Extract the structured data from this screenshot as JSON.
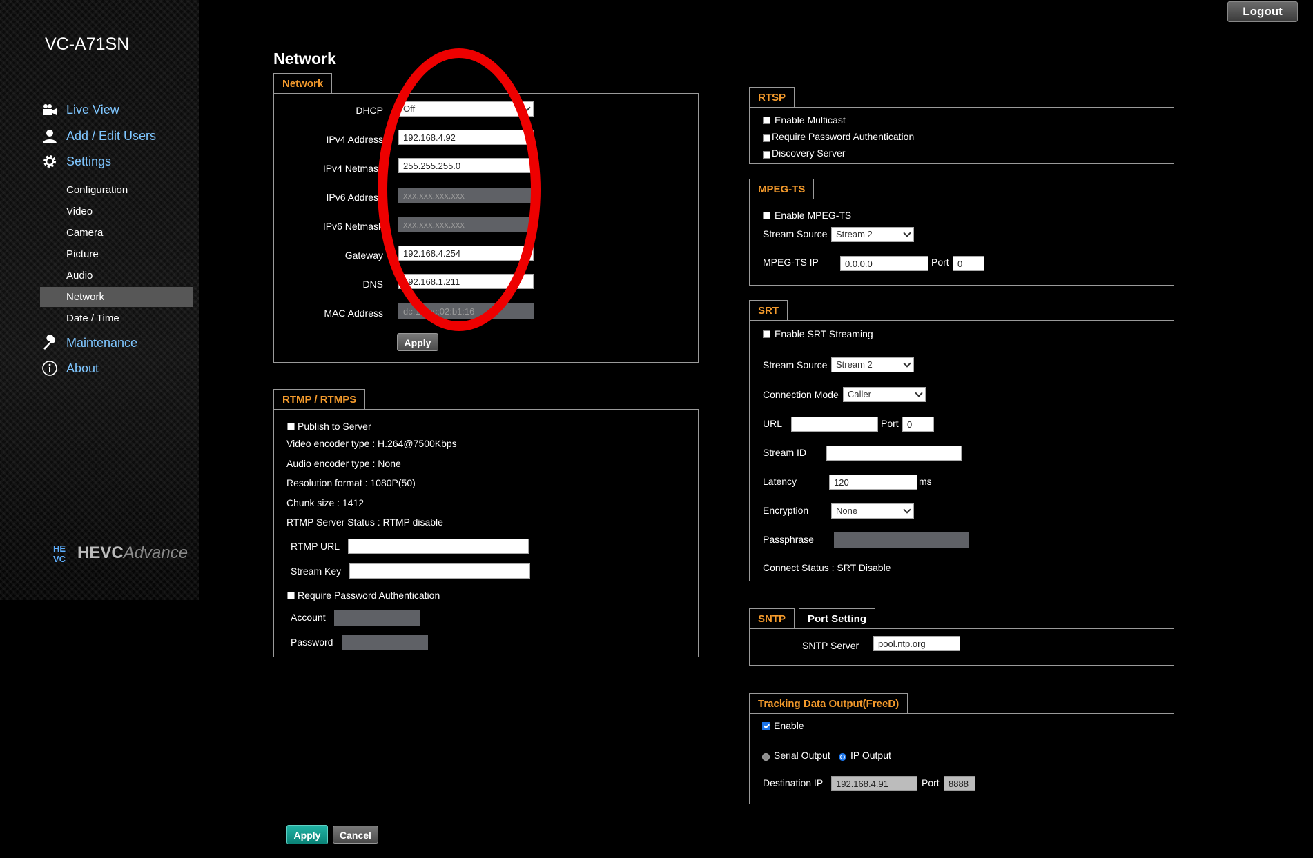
{
  "model_name": "VC-A71SN",
  "logout_label": "Logout",
  "page_title": "Network",
  "nav": {
    "main": [
      {
        "label": "Live View",
        "icon": "camera-icon"
      },
      {
        "label": "Add / Edit Users",
        "icon": "user-icon"
      },
      {
        "label": "Settings",
        "icon": "gear-icon"
      },
      {
        "label": "Maintenance",
        "icon": "wrench-icon"
      },
      {
        "label": "About",
        "icon": "info-icon"
      }
    ],
    "sub": [
      "Configuration",
      "Video",
      "Camera",
      "Picture",
      "Audio",
      "Network",
      "Date / Time"
    ],
    "active_sub": "Network"
  },
  "logo": {
    "mark": "HE\nVC",
    "text_bold": "HEVC",
    "text_light": "Advance"
  },
  "network_panel": {
    "tab": "Network",
    "fields": [
      {
        "label": "DHCP",
        "value": "Off",
        "type": "select"
      },
      {
        "label": "IPv4 Address",
        "value": "192.168.4.92",
        "type": "text"
      },
      {
        "label": "IPv4 Netmask",
        "value": "255.255.255.0",
        "type": "text"
      },
      {
        "label": "IPv6 Address",
        "value": "xxx.xxx.xxx.xxx",
        "type": "disabled"
      },
      {
        "label": "IPv6 Netmask",
        "value": "xxx.xxx.xxx.xxx",
        "type": "disabled"
      },
      {
        "label": "Gateway",
        "value": "192.168.4.254",
        "type": "text"
      },
      {
        "label": "DNS",
        "value": "192.168.1.211",
        "type": "text"
      },
      {
        "label": "MAC Address",
        "value": "dc:12:ac:02:b1:16",
        "type": "disabled"
      }
    ],
    "apply_label": "Apply"
  },
  "rtmp_panel": {
    "tab": "RTMP / RTMPS",
    "publish_label": "Publish to Server",
    "publish_checked": false,
    "info": [
      "Video encoder type : H.264@7500Kbps",
      "Audio encoder type : None",
      "Resolution format : 1080P(50)",
      "Chunk size : 1412",
      "RTMP Server Status : RTMP disable"
    ],
    "rtmp_url_label": "RTMP URL",
    "rtmp_url_value": "",
    "stream_key_label": "Stream Key",
    "stream_key_value": "",
    "require_auth_label": "Require Password Authentication",
    "require_auth_checked": false,
    "account_label": "Account",
    "password_label": "Password"
  },
  "rtsp_panel": {
    "tab": "RTSP",
    "options": [
      {
        "label": "Enable Multicast",
        "checked": false
      },
      {
        "label": "Require Password Authentication",
        "checked": false
      },
      {
        "label": "Discovery Server",
        "checked": false
      }
    ]
  },
  "mpegts_panel": {
    "tab": "MPEG-TS",
    "enable_label": "Enable MPEG-TS",
    "enable_checked": false,
    "stream_source_label": "Stream Source",
    "stream_source_value": "Stream 2",
    "ip_label": "MPEG-TS IP",
    "ip_value": "0.0.0.0",
    "port_label": "Port",
    "port_value": "0"
  },
  "srt_panel": {
    "tab": "SRT",
    "enable_label": "Enable SRT Streaming",
    "enable_checked": false,
    "stream_source_label": "Stream Source",
    "stream_source_value": "Stream 2",
    "connection_mode_label": "Connection Mode",
    "connection_mode_value": "Caller",
    "url_label": "URL",
    "url_value": "",
    "port_label": "Port",
    "port_value": "0",
    "stream_id_label": "Stream ID",
    "stream_id_value": "",
    "latency_label": "Latency",
    "latency_value": "120",
    "latency_unit": "ms",
    "encryption_label": "Encryption",
    "encryption_value": "None",
    "passphrase_label": "Passphrase",
    "connect_status": "Connect Status : SRT Disable"
  },
  "sntp_panel": {
    "tabs": [
      "SNTP",
      "Port Setting"
    ],
    "server_label": "SNTP Server",
    "server_value": "pool.ntp.org"
  },
  "freed_panel": {
    "tab": "Tracking Data Output(FreeD)",
    "enable_label": "Enable",
    "enable_checked": true,
    "serial_label": "Serial Output",
    "ip_output_label": "IP Output",
    "selected_output": "IP Output",
    "dest_ip_label": "Destination IP",
    "dest_ip_value": "192.168.4.91",
    "port_label": "Port",
    "port_value": "8888"
  },
  "footer": {
    "apply_label": "Apply",
    "cancel_label": "Cancel"
  },
  "colors": {
    "accent_orange": "#f39a2c",
    "nav_link": "#7fc6ff",
    "annotation_red": "#ee0000",
    "teal": "#0b8478"
  }
}
